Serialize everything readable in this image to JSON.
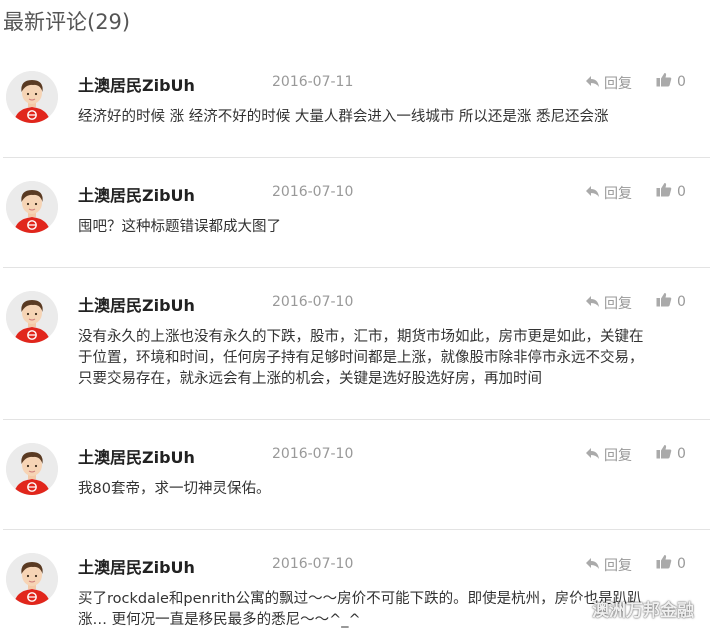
{
  "title": "最新评论(29)",
  "comments": [
    {
      "user": "土澳居民ZibUh",
      "date": "2016-07-11",
      "reply": "回复",
      "likes": "0",
      "lines": [
        "经济好的时候 涨 经济不好的时候 大量人群会进入一线城市 所以还是涨 悉尼还会涨"
      ]
    },
    {
      "user": "土澳居民ZibUh",
      "date": "2016-07-10",
      "reply": "回复",
      "likes": "0",
      "lines": [
        "囤吧？这种标题错误都成大图了"
      ]
    },
    {
      "user": "土澳居民ZibUh",
      "date": "2016-07-10",
      "reply": "回复",
      "likes": "0",
      "lines": [
        "没有永久的上涨也没有永久的下跌，股市，汇市，期货市场如此，房市更是如此，关键在",
        "于位置，环境和时间，任何房子持有足够时间都是上涨，就像股市除非停市永远不交易，",
        "只要交易存在，就永远会有上涨的机会，关键是选好股选好房，再加时间"
      ]
    },
    {
      "user": "土澳居民ZibUh",
      "date": "2016-07-10",
      "reply": "回复",
      "likes": "0",
      "lines": [
        "我80套帝，求一切神灵保佑。"
      ]
    },
    {
      "user": "土澳居民ZibUh",
      "date": "2016-07-10",
      "reply": "回复",
      "likes": "0",
      "lines": [
        "买了rockdale和penrith公寓的飘过～～房价不可能下跌的。即使是杭州，房价也是趴趴",
        "涨… 更何况一直是移民最多的悉尼～～^_^"
      ]
    }
  ],
  "watermark": "澳洲万邦金融",
  "icons": {
    "reply": "reply-arrow-icon",
    "like": "thumbs-up-icon",
    "avatar": "cartoon-avatar",
    "watermark": "wechat-icon"
  },
  "colors": {
    "accent": "#e53935",
    "meta": "#999999",
    "divider": "#e3e3e3"
  }
}
